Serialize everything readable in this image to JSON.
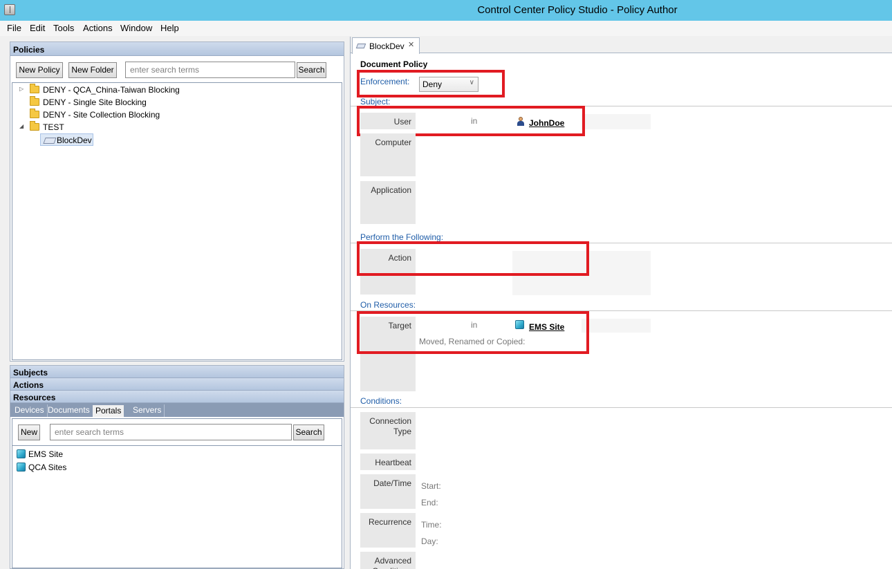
{
  "window": {
    "title": "Control Center Policy Studio - Policy Author"
  },
  "menu": [
    "File",
    "Edit",
    "Tools",
    "Actions",
    "Window",
    "Help"
  ],
  "policies_pane": {
    "header": "Policies",
    "new_policy": "New Policy",
    "new_folder": "New Folder",
    "search_placeholder": "enter search terms",
    "search_button": "Search",
    "tree": [
      {
        "label": "DENY - QCA_China-Taiwan Blocking"
      },
      {
        "label": "DENY - Single Site Blocking"
      },
      {
        "label": "DENY - Site Collection Blocking"
      },
      {
        "label": "TEST"
      },
      {
        "label": "BlockDev"
      }
    ]
  },
  "components_pane": {
    "sections": [
      "Subjects",
      "Actions",
      "Resources"
    ],
    "tabs": [
      "Devices",
      "Documents",
      "Portals",
      "Servers"
    ],
    "active_tab": "Portals",
    "new_button": "New",
    "search_placeholder": "enter search terms",
    "search_button": "Search",
    "items": [
      "EMS Site",
      "QCA Sites"
    ]
  },
  "editor": {
    "tab_label": "BlockDev",
    "doc_title": "Document Policy",
    "enforcement_label": "Enforcement:",
    "enforcement_value": "Deny",
    "subject_label": "Subject:",
    "user_label": "User",
    "in_text": "in",
    "user_value": "JohnDoe",
    "computer_label": "Computer",
    "application_label": "Application",
    "perform_label": "Perform the Following:",
    "action_label": "Action",
    "resources_label": "On Resources:",
    "target_label": "Target",
    "target_value": "EMS Site",
    "moved_text": "Moved, Renamed or Copied:",
    "conditions_label": "Conditions:",
    "connection_type": "Connection Type",
    "heartbeat": "Heartbeat",
    "datetime": "Date/Time",
    "start": "Start:",
    "end": "End:",
    "recurrence": "Recurrence",
    "time": "Time:",
    "day": "Day:",
    "advanced": "Advanced Conditions"
  },
  "colors": {
    "title_bar": "#63c6e8",
    "highlight_box": "#e11b22",
    "section_label": "#1f5da8"
  }
}
